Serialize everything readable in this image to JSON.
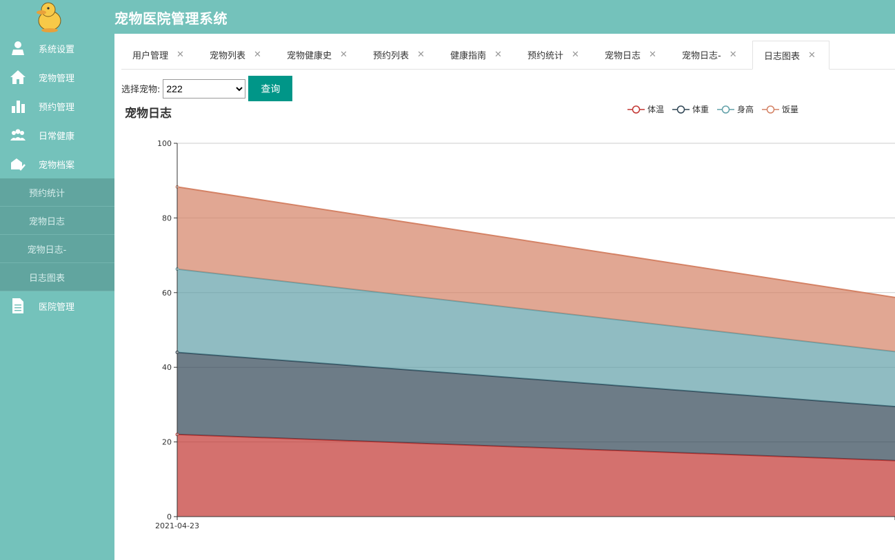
{
  "header": {
    "title": "宠物医院管理系统"
  },
  "sidebar": {
    "items": [
      {
        "label": "系统设置",
        "icon": "user-icon"
      },
      {
        "label": "宠物管理",
        "icon": "home-icon"
      },
      {
        "label": "预约管理",
        "icon": "bar-chart-icon"
      },
      {
        "label": "日常健康",
        "icon": "group-icon"
      },
      {
        "label": "宠物档案",
        "icon": "archive-check-icon"
      }
    ],
    "sub_items": [
      "预约统计",
      "宠物日志",
      "宠物日志-",
      "日志图表"
    ],
    "last_item": {
      "label": "医院管理",
      "icon": "document-icon"
    }
  },
  "tabs": [
    "用户管理",
    "宠物列表",
    "宠物健康史",
    "预约列表",
    "健康指南",
    "预约统计",
    "宠物日志",
    "宠物日志-",
    "日志图表"
  ],
  "active_tab": "日志图表",
  "filter": {
    "label": "选择宠物:",
    "selected": "222",
    "button": "查询"
  },
  "colors": {
    "accent": "#74c2bb",
    "button": "#009688"
  },
  "chart_data": {
    "type": "area",
    "stacked": true,
    "title": "宠物日志",
    "x": [
      "2021-04-23",
      ""
    ],
    "ylim": [
      0,
      100
    ],
    "yticks": [
      "0",
      "20",
      "40",
      "60",
      "80",
      "100"
    ],
    "grid": true,
    "legend": "top-right",
    "series": [
      {
        "name": "体温",
        "values": [
          22,
          15
        ],
        "color": "#c23531"
      },
      {
        "name": "体重",
        "values": [
          22,
          14.5
        ],
        "color": "#2f4554"
      },
      {
        "name": "身高",
        "values": [
          22.3,
          14.7
        ],
        "color": "#61a0a8"
      },
      {
        "name": "饭量",
        "values": [
          22,
          14.5
        ],
        "color": "#d48265"
      }
    ]
  }
}
